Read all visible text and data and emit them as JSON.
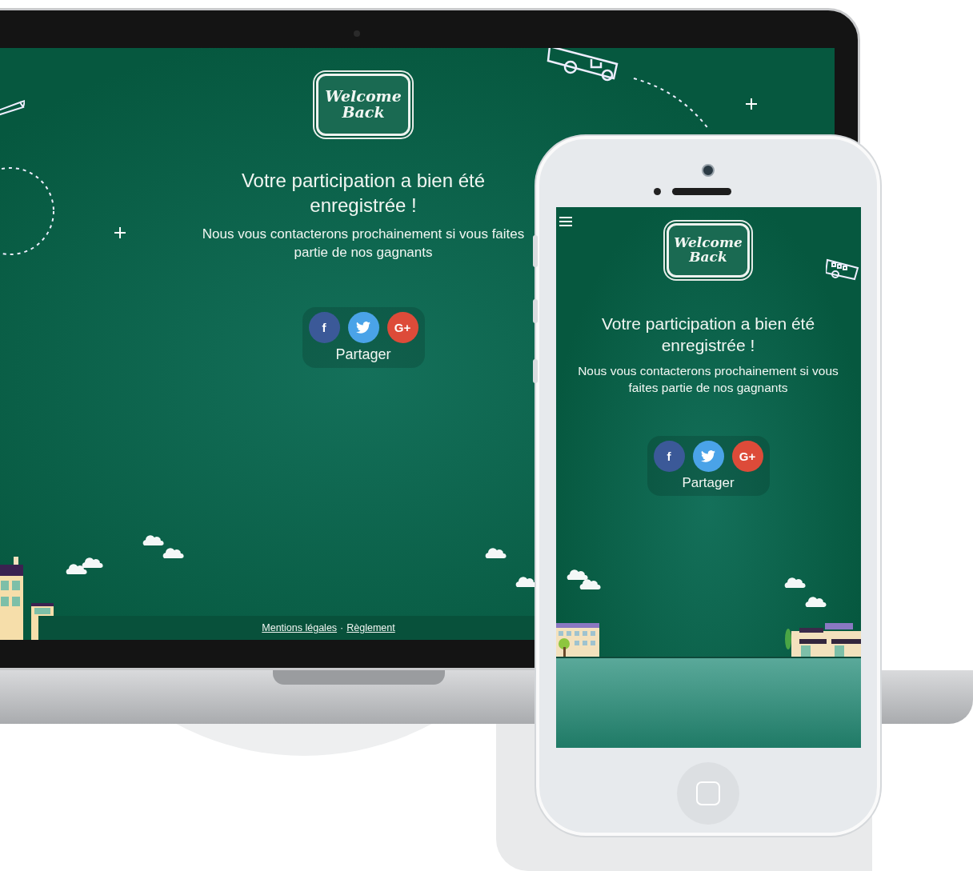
{
  "laptop": {
    "screen": {
      "logo": {
        "line_1": "Welcome",
        "line_2": "Back"
      },
      "title": "Votre participation a bien été enregistrée !",
      "message": "Nous vous contacterons prochainement si vous faites partie de nos gagnants",
      "share": {
        "buttons": [
          {
            "kind": "facebook",
            "label": "f"
          },
          {
            "kind": "twitter"
          },
          {
            "kind": "google",
            "label": "G+"
          }
        ],
        "label": "Partager"
      },
      "footer": {
        "links": [
          "Mentions légales",
          "Règlement"
        ],
        "separator": "·"
      }
    }
  },
  "phone": {
    "screen": {
      "logo": {
        "line_1": "Welcome",
        "line_2": "Back"
      },
      "title": "Votre participation a bien été enregistrée !",
      "message": "Nous vous contacterons prochainement si vous faites partie de nos gagnants",
      "share": {
        "buttons": [
          {
            "kind": "facebook",
            "label": "f"
          },
          {
            "kind": "twitter"
          },
          {
            "kind": "google",
            "label": "G+"
          }
        ],
        "label": "Partager"
      }
    }
  }
}
